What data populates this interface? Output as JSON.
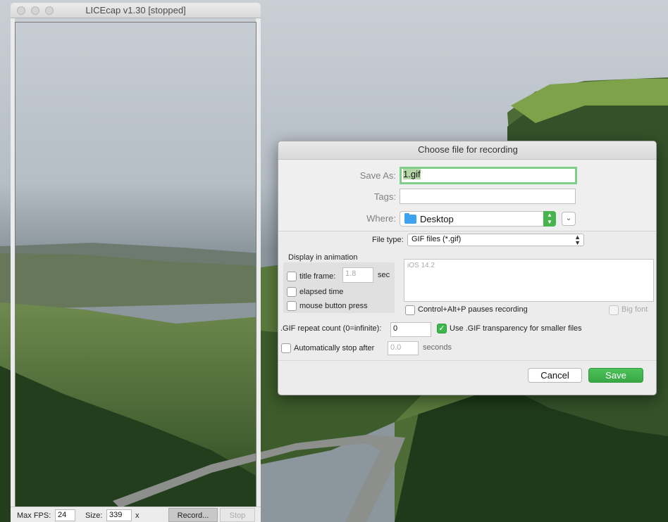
{
  "licecap": {
    "title": "LICEcap v1.30 [stopped]",
    "max_fps_label": "Max FPS:",
    "max_fps_value": "24",
    "size_label": "Size:",
    "size_width": "339",
    "size_x": "x",
    "record_label": "Record...",
    "stop_label": "Stop"
  },
  "dialog": {
    "title": "Choose file for recording",
    "save_as_label": "Save As:",
    "save_as_value": "1.gif",
    "tags_label": "Tags:",
    "tags_value": "",
    "where_label": "Where:",
    "where_value": "Desktop",
    "file_type_label": "File type:",
    "file_type_value": "GIF files (*.gif)",
    "display_in_animation": "Display in animation",
    "title_frame_label": "title frame:",
    "title_frame_value": "1.8",
    "sec_label": "sec",
    "elapsed_time_label": "elapsed time",
    "mouse_button_label": "mouse button press",
    "notes_text": "iOS 14.2",
    "pause_label": "Control+Alt+P pauses recording",
    "big_font_label": "Big font",
    "repeat_label": ".GIF repeat count (0=infinite):",
    "repeat_value": "0",
    "transparency_label": "Use .GIF transparency for smaller files",
    "auto_stop_label": "Automatically stop after",
    "auto_stop_value": "0.0",
    "seconds_label": "seconds",
    "cancel_label": "Cancel",
    "save_label": "Save",
    "transparency_checked": true,
    "accent_color": "#3fb54d"
  }
}
